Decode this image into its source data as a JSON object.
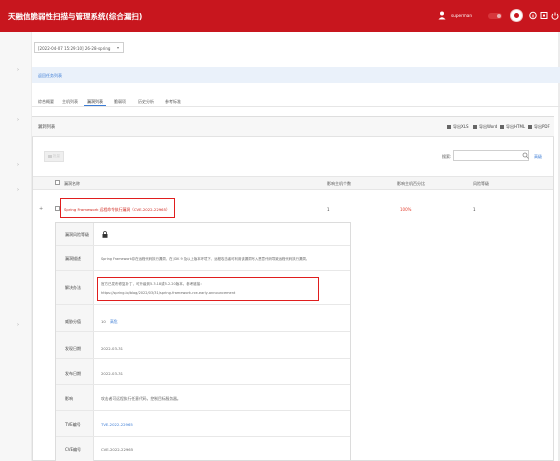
{
  "header": {
    "app_title": "天融信脆弱性扫描与管理系统(综合漏扫)",
    "user_name": "superman",
    "icons": [
      "user-icon",
      "alert-badge",
      "avatar-logo",
      "info-icon",
      "settings-icon",
      "logout-icon"
    ]
  },
  "task_select": {
    "value": "[2022-04-07 15:29:10] 26-28-spring"
  },
  "back_link": "返回任务列表",
  "tabs": [
    "综合概要",
    "主机列表",
    "漏洞列表",
    "脆弱项",
    "历史分析",
    "参考标准"
  ],
  "active_tab": 2,
  "panel": {
    "title": "漏洞列表",
    "exports": [
      "导出XLS",
      "导出Word",
      "导出HTML",
      "导出PDF"
    ]
  },
  "toolbar": {
    "disabled_button": "批量",
    "search_label": "搜索:",
    "search_value": "",
    "advanced_link": "高级"
  },
  "table": {
    "columns": [
      "漏洞名称",
      "影响主机个数",
      "影响主机百分比",
      "风险等级"
    ],
    "row": {
      "expander": "+",
      "name": "Spring Framework 远程命令执行漏洞（CVE-2022-22965）",
      "host_count": "1",
      "percent": "100%",
      "risk": "1"
    }
  },
  "detail": {
    "rows": [
      {
        "label": "漏洞风险等级",
        "value": ""
      },
      {
        "label": "漏洞描述",
        "value": "Spring Framework存在远程代码执行漏洞，在 JDK 9 及以上版本环境下，远程攻击者可利用该漏洞写入恶意代码导致远程代码执行漏洞。"
      },
      {
        "label": "解决办法",
        "value": "官方已发布修复补丁，可升级到5.3.18或5.2.20版本。参考链接：",
        "value2": "https://spring.io/blog/2022/03/31/spring-framework-rce-early-announcement"
      },
      {
        "label": "威胁分值",
        "value": "10",
        "extra": "高危"
      },
      {
        "label": "发现日期",
        "value": "2022-03-31"
      },
      {
        "label": "发布日期",
        "value": "2022-03-31"
      },
      {
        "label": "影响",
        "value": "攻击者可远程执行任意代码，控制目标服务器。"
      },
      {
        "label": "TVE编号",
        "value": "TVE-2022-22965"
      },
      {
        "label": "CVE编号",
        "value": "CVE-2022-22965"
      }
    ]
  }
}
